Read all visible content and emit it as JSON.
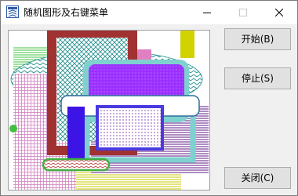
{
  "window": {
    "title": "随机图形及右键菜单",
    "controls": [
      "minimize",
      "maximize",
      "close"
    ]
  },
  "buttons": {
    "start": "开始(B)",
    "stop": "停止(S)",
    "close": "关闭(C)"
  },
  "colors": {
    "client_background": "#f0f0f0",
    "canvas_background": "#ffffff",
    "button_face": "#e1e1e1",
    "shape_colors": [
      "#a03232",
      "#1e8c8c",
      "#7fd1cf",
      "#9b30ff",
      "#3c14e6",
      "#d2d200",
      "#8b5aa8",
      "#c080c0",
      "#40c040",
      "#e080c0",
      "#2c2c8c"
    ]
  },
  "icons": {
    "app": "app-window-icon",
    "minimize": "minimize-icon",
    "maximize": "maximize-icon",
    "close": "close-icon"
  }
}
